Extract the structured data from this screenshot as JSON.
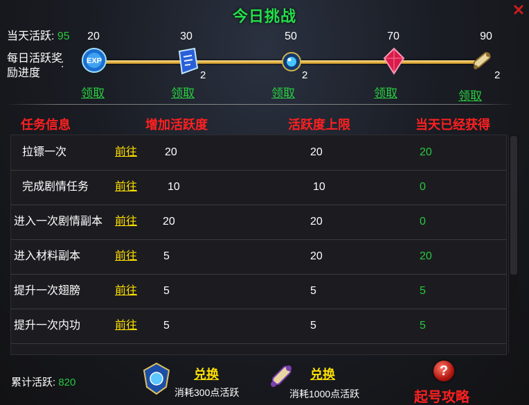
{
  "window": {
    "title": "今日挑战",
    "close_label": "✕"
  },
  "activity": {
    "today_label": "当天活跃:",
    "today_value": "95",
    "reward_label": "每日活跃奖励进度",
    "colon": ":"
  },
  "milestones": [
    {
      "points": "20",
      "claim_label": "领取",
      "count": "",
      "icon": "exp-orb-icon"
    },
    {
      "points": "30",
      "claim_label": "领取",
      "count": "2",
      "icon": "blue-scroll-icon"
    },
    {
      "points": "50",
      "claim_label": "领取",
      "count": "2",
      "icon": "blue-gem-icon"
    },
    {
      "points": "70",
      "claim_label": "领取",
      "count": "",
      "icon": "red-crystal-icon"
    },
    {
      "points": "90",
      "claim_label": "领取",
      "count": "2",
      "icon": "scroll-roll-icon"
    }
  ],
  "columns": {
    "task": "任务信息",
    "add": "增加活跃度",
    "limit": "活跃度上限",
    "obtained": "当天已经获得"
  },
  "tasks": [
    {
      "name": "拉镖一次",
      "go": "前往",
      "add": "20",
      "limit": "20",
      "obtained": "20"
    },
    {
      "name": "完成剧情任务",
      "go": "前往",
      "add": "10",
      "limit": "10",
      "obtained": "0"
    },
    {
      "name": "进入一次剧情副本",
      "go": "前往",
      "add": "20",
      "limit": "20",
      "obtained": "0"
    },
    {
      "name": "进入材料副本",
      "go": "前往",
      "add": "5",
      "limit": "20",
      "obtained": "20"
    },
    {
      "name": "提升一次翅膀",
      "go": "前往",
      "add": "5",
      "limit": "5",
      "obtained": "5"
    },
    {
      "name": "提升一次内功",
      "go": "前往",
      "add": "5",
      "limit": "5",
      "obtained": "5"
    }
  ],
  "footer": {
    "total_label": "累计活跃:",
    "total_value": "820",
    "exchange1": {
      "label": "兑换",
      "cost": "消耗300点活跃"
    },
    "exchange2": {
      "label": "兑换",
      "cost": "消耗1000点活跃"
    },
    "guide_label": "起号攻略",
    "help_glyph": "?"
  },
  "colors": {
    "green": "#28c840",
    "yellow": "#ffe000",
    "red": "#ff2020",
    "track": "#f0c040"
  }
}
